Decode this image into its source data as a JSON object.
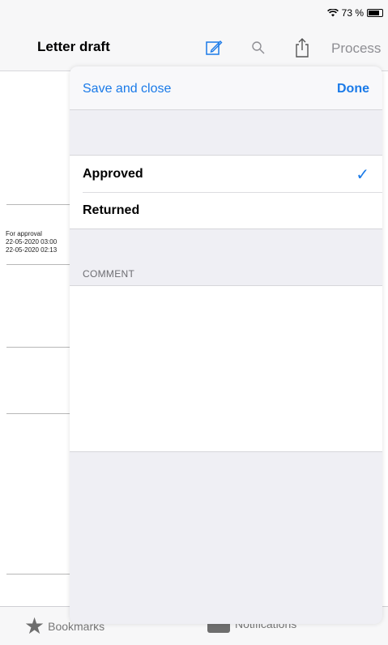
{
  "status": {
    "battery_text": "73 %"
  },
  "nav": {
    "title": "Letter draft",
    "process_label": "Process"
  },
  "background_doc": {
    "lines": [
      "For approval",
      "22-05-2020 03:00",
      "22-05-2020 02:13"
    ]
  },
  "sheet": {
    "save_label": "Save and close",
    "done_label": "Done",
    "options": [
      {
        "label": "Approved",
        "selected": true
      },
      {
        "label": "Returned",
        "selected": false
      }
    ],
    "comment_header": "COMMENT",
    "comment_value": ""
  },
  "tabbar": {
    "bookmarks_label": "Bookmarks",
    "notifications_label": "Notifications"
  },
  "colors": {
    "accent": "#1a7ae8",
    "badge": "#d83a2a"
  }
}
